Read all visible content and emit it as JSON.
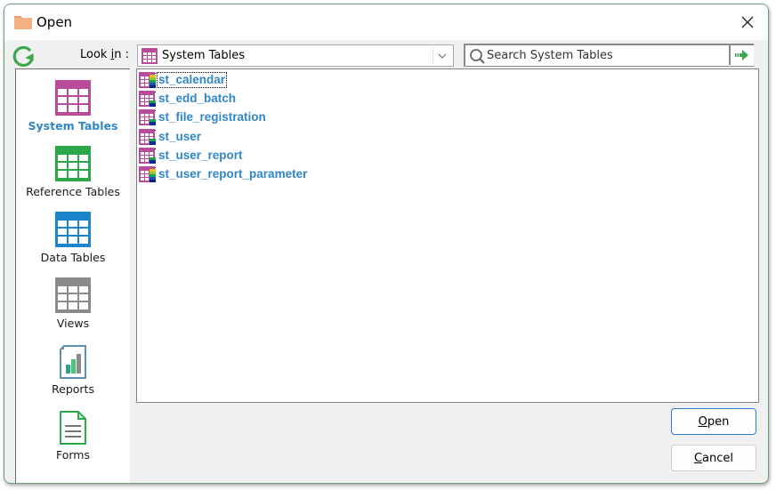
{
  "window": {
    "title": "Open",
    "title_icon": "folder-icon",
    "close_icon": "close-icon"
  },
  "toolbar": {
    "refresh_icon": "refresh-icon",
    "look_in_label": "Look in :",
    "look_in_mnemonic": "i",
    "look_in_value": "System Tables",
    "search_placeholder": "Search System Tables",
    "search_value": "",
    "search_go_icon": "green-arrow-icon"
  },
  "sidebar": {
    "items": [
      {
        "label": "System Tables",
        "icon": "system-table-icon",
        "color": "#b84c9a",
        "active": true
      },
      {
        "label": "Reference Tables",
        "icon": "reference-table-icon",
        "color": "#2aa84a",
        "active": false
      },
      {
        "label": "Data Tables",
        "icon": "data-table-icon",
        "color": "#1a85c8",
        "active": false
      },
      {
        "label": "Views",
        "icon": "view-table-icon",
        "color": "#8a8a8a",
        "active": false
      },
      {
        "label": "Reports",
        "icon": "report-icon",
        "color": "#5f8fb0",
        "active": false
      },
      {
        "label": "Forms",
        "icon": "form-icon",
        "color": "#2aa84a",
        "active": false
      }
    ]
  },
  "files": [
    {
      "name": "st_calendar",
      "focused": true,
      "variant": "rainbow"
    },
    {
      "name": "st_edd_batch",
      "focused": false,
      "variant": "plain"
    },
    {
      "name": "st_file_registration",
      "focused": false,
      "variant": "plain"
    },
    {
      "name": "st_user",
      "focused": false,
      "variant": "plain"
    },
    {
      "name": "st_user_report",
      "focused": false,
      "variant": "plain"
    },
    {
      "name": "st_user_report_parameter",
      "focused": false,
      "variant": "rainbow"
    }
  ],
  "buttons": {
    "open": {
      "label": "Open",
      "mnemonic": "O",
      "rest": "pen"
    },
    "cancel": {
      "label": "Cancel",
      "mnemonic": "C",
      "rest": "ancel"
    }
  },
  "colors": {
    "accent_link": "#2f86c9",
    "system_tables": "#b84c9a",
    "reference_tables": "#2aa84a",
    "data_tables": "#1a85c8",
    "views": "#8a8a8a"
  }
}
